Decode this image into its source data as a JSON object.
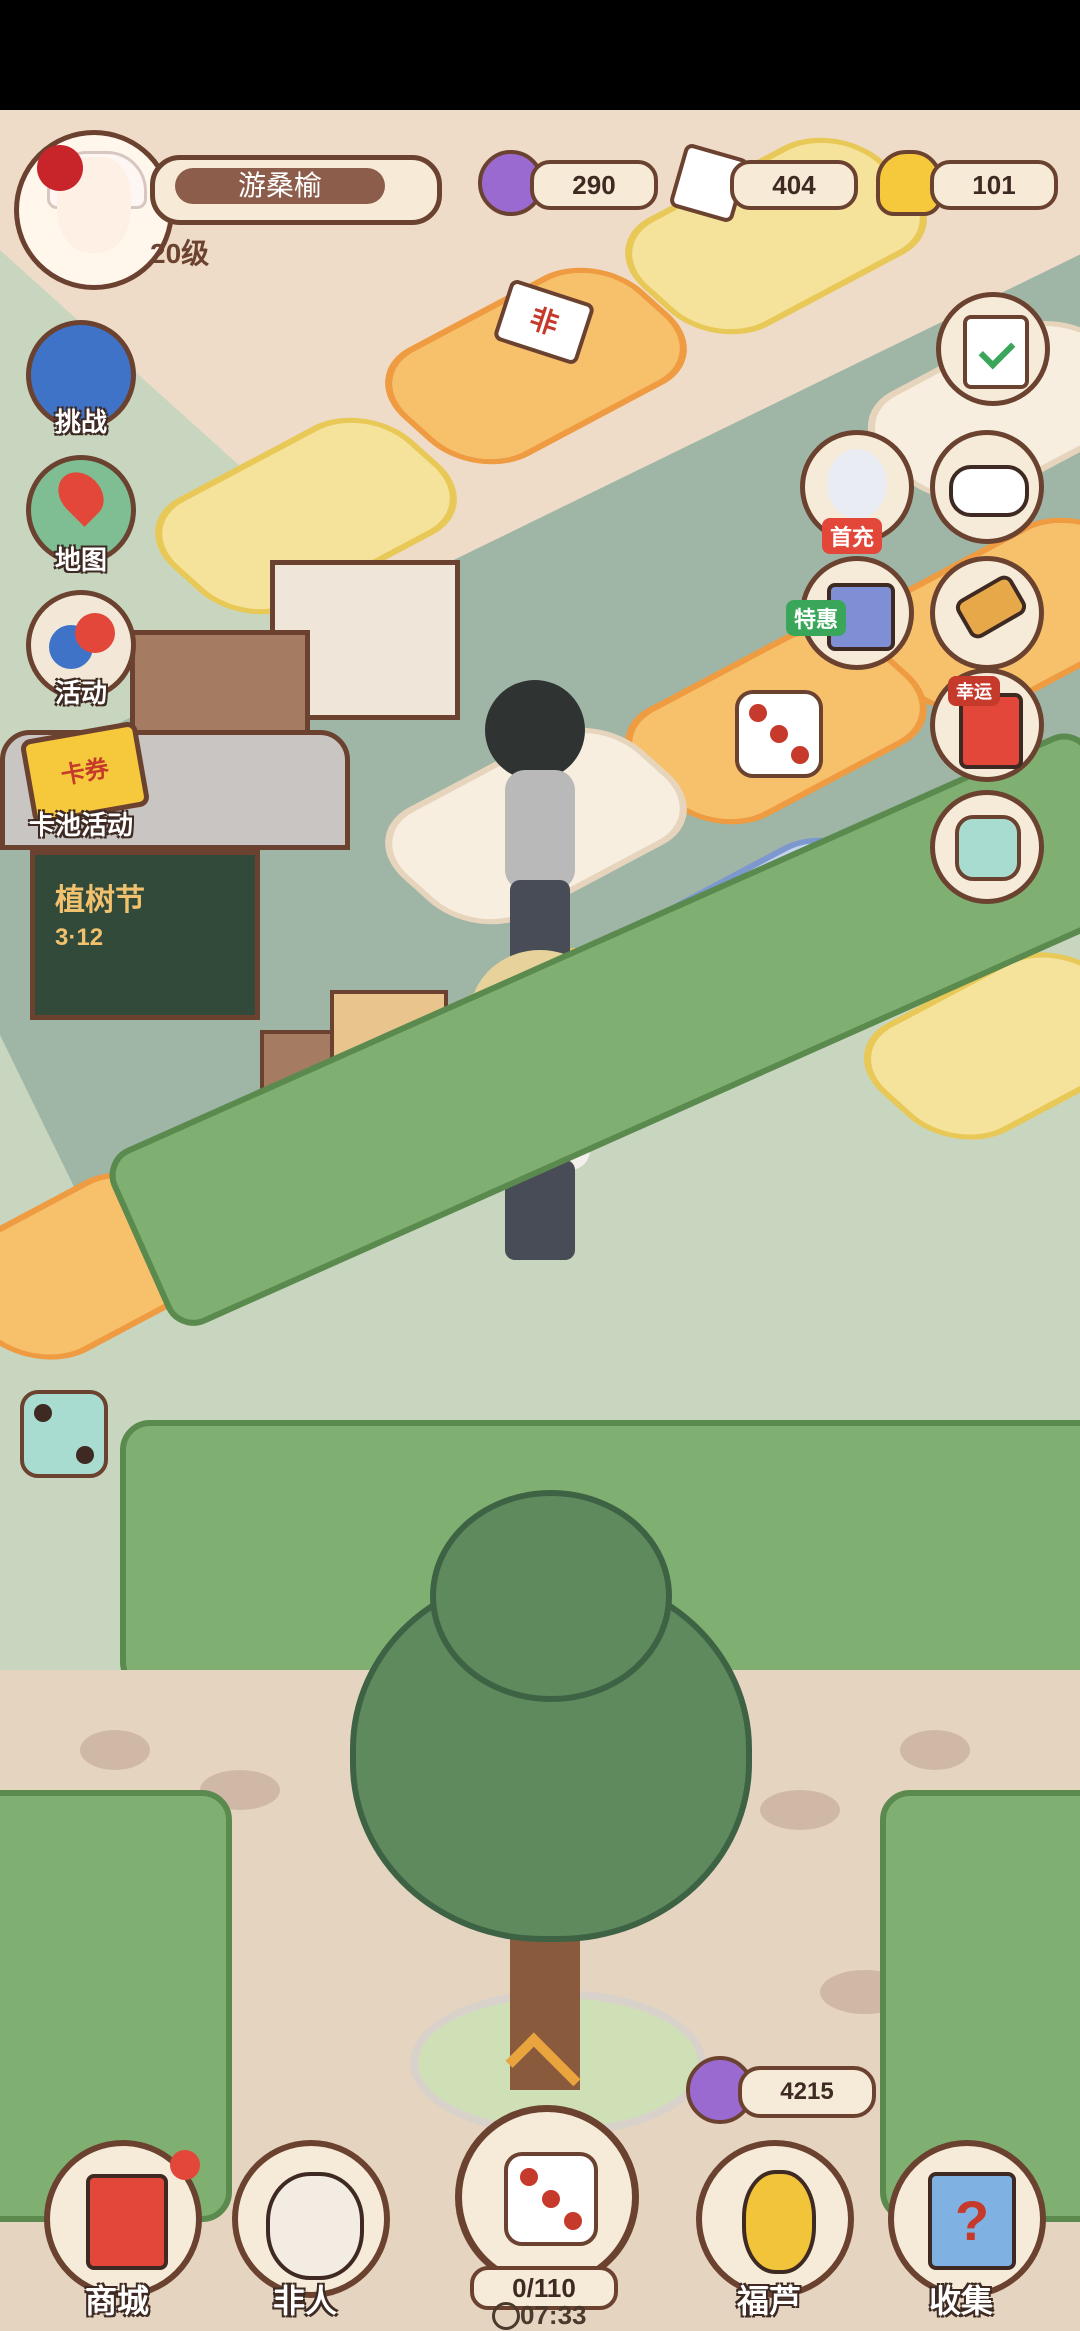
{
  "player": {
    "name": "游桑榆",
    "level": "20级"
  },
  "resources": [
    {
      "icon": "swirl-icon",
      "value": "290"
    },
    {
      "icon": "ticket-icon",
      "value": "404"
    },
    {
      "icon": "gold-ingot-icon",
      "value": "101"
    }
  ],
  "left_menu": {
    "challenge": "挑战",
    "map": "地图",
    "activity": "活动",
    "card_pool": "卡池活动",
    "card_pool_badge": "卡券"
  },
  "right_menu": {
    "first_recharge": "首充",
    "special_offer": "特惠",
    "lucky": "幸运"
  },
  "board": {
    "sign_text": "植树节",
    "sign_date": "3·12",
    "tile_ticket_label": "非"
  },
  "points_pill": "4215",
  "bottom_bar": {
    "shop": "商城",
    "feiren": "非人",
    "dice_counter": "0/110",
    "timer": "07:33",
    "gourd": "福芦",
    "collect": "收集"
  },
  "colors": {
    "outline": "#6b4230",
    "accent_orange": "#ee9b41",
    "accent_yellow": "#e8c857",
    "accent_purple": "#9a6ad1",
    "accent_red": "#c63a2c"
  }
}
